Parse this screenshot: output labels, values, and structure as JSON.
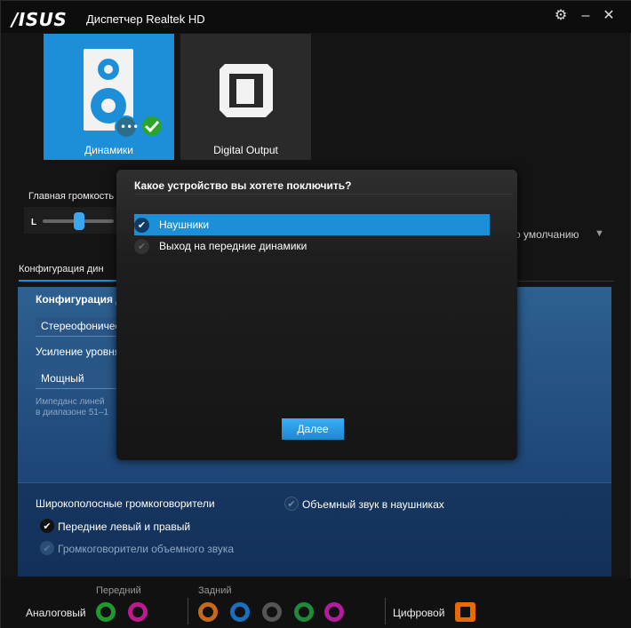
{
  "window": {
    "logo": "/ISUS",
    "title": "Диспетчер Realtek HD",
    "buttons": {
      "settings": "⚙",
      "minimize": "–",
      "close": "✕"
    }
  },
  "devices": [
    {
      "label": "Динамики",
      "icon": "speaker-icon",
      "selected": true
    },
    {
      "label": "Digital Output",
      "icon": "digital-output-icon",
      "selected": false
    }
  ],
  "volume": {
    "label": "Главная громкость",
    "left_channel": "L",
    "default_text": "о умолчанию"
  },
  "tabs": [
    {
      "label": "Конфигурация дин"
    }
  ],
  "config": {
    "heading": "Конфигурация д",
    "speaker_config_value": "Стереофонические",
    "boost_label": "Усиление уровня",
    "boost_value": "Мощный",
    "impedance_line1": "Импеданс линей",
    "impedance_line2": "в диапазоне 51–1"
  },
  "lower": {
    "fullrange_label": "Широкополосные громкоговорители",
    "front_lr": "Передние левый и правый",
    "surround": "Громкоговорители объемного звука",
    "virtual_surround": "Объемный звук в наушниках"
  },
  "jacks": {
    "front_label": "Передний",
    "rear_label": "Задний",
    "analog_label": "Аналоговый",
    "digital_label": "Цифровой",
    "front_colors": [
      "#1e9a2e",
      "#c0198f"
    ],
    "rear_colors": [
      "#c66a1a",
      "#1a6fbf",
      "#555555",
      "#1e8a3a",
      "#b01c9a"
    ]
  },
  "modal": {
    "title": "Какое устройство вы хотете поключить?",
    "options": [
      {
        "label": "Наушники",
        "selected": true
      },
      {
        "label": "Выход на передние динамики",
        "selected": false
      }
    ],
    "next_label": "Далее"
  },
  "colors": {
    "accent": "#1c8fd8",
    "panel": "#2b5c8e",
    "optical": "#e86a00"
  }
}
